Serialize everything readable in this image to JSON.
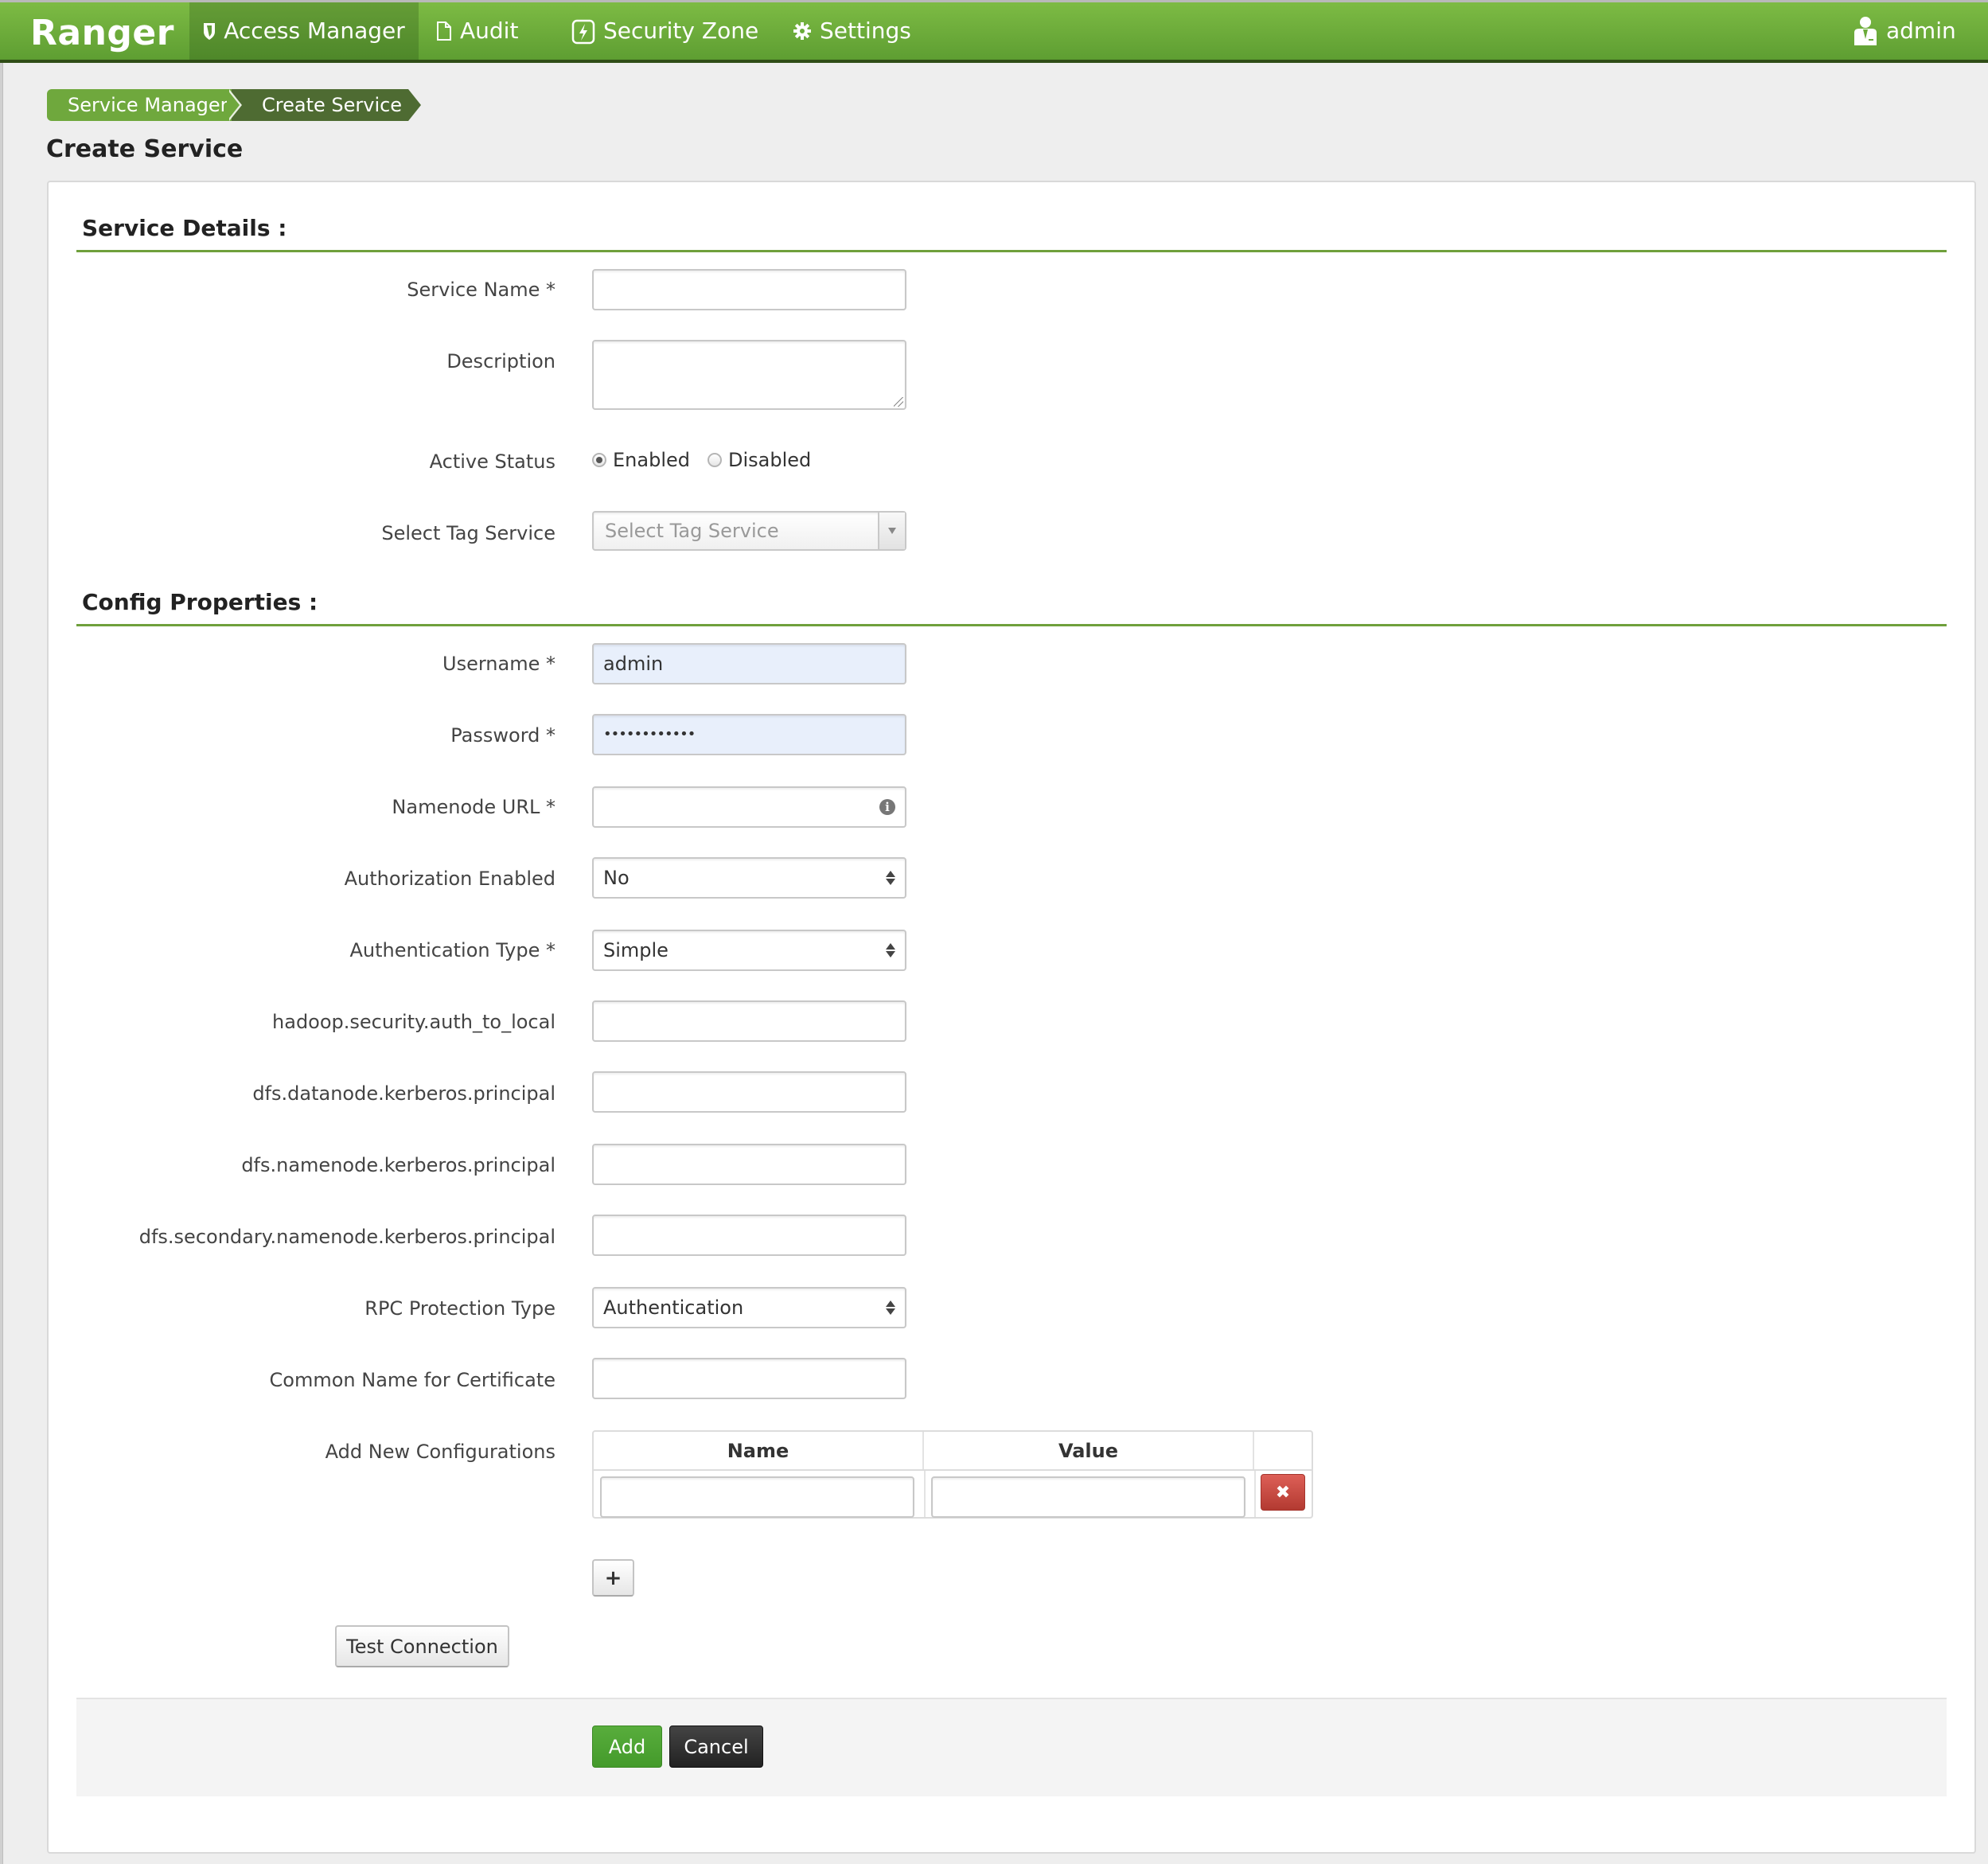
{
  "navbar": {
    "brand": "Ranger",
    "items": [
      {
        "label": "Access Manager",
        "icon": "shield-icon",
        "active": true
      },
      {
        "label": "Audit",
        "icon": "file-icon",
        "active": false
      },
      {
        "label": "Security Zone",
        "icon": "lightning-icon",
        "active": false
      },
      {
        "label": "Settings",
        "icon": "gear-icon",
        "active": false
      }
    ],
    "user": {
      "label": "admin",
      "icon": "user-icon"
    }
  },
  "breadcrumb": [
    "Service Manager",
    "Create Service"
  ],
  "page_title": "Create Service",
  "service_details": {
    "title": "Service Details :",
    "service_name": {
      "label": "Service Name *",
      "value": ""
    },
    "description": {
      "label": "Description",
      "value": ""
    },
    "active_status": {
      "label": "Active Status",
      "options": [
        "Enabled",
        "Disabled"
      ],
      "selected": "Enabled"
    },
    "tag_service": {
      "label": "Select Tag Service",
      "placeholder": "Select Tag Service"
    }
  },
  "config_properties": {
    "title": "Config Properties :",
    "username": {
      "label": "Username *",
      "value": "admin"
    },
    "password": {
      "label": "Password *",
      "value": "••••••••••••"
    },
    "namenode_url": {
      "label": "Namenode URL *",
      "value": "",
      "icon": "info-icon"
    },
    "authorization_enabled": {
      "label": "Authorization Enabled",
      "value": "No"
    },
    "authentication_type": {
      "label": "Authentication Type *",
      "value": "Simple"
    },
    "auth_to_local": {
      "label": "hadoop.security.auth_to_local",
      "value": ""
    },
    "datanode_principal": {
      "label": "dfs.datanode.kerberos.principal",
      "value": ""
    },
    "namenode_principal": {
      "label": "dfs.namenode.kerberos.principal",
      "value": ""
    },
    "secondary_namenode_principal": {
      "label": "dfs.secondary.namenode.kerberos.principal",
      "value": ""
    },
    "rpc_protection": {
      "label": "RPC Protection Type",
      "value": "Authentication"
    },
    "common_name_cert": {
      "label": "Common Name for Certificate",
      "value": ""
    },
    "new_configs": {
      "label": "Add New Configurations",
      "columns": [
        "Name",
        "Value"
      ],
      "rows": [
        {
          "name": "",
          "value": ""
        }
      ],
      "delete_glyph": "✖",
      "add_glyph": "+"
    }
  },
  "buttons": {
    "test_connection": "Test Connection",
    "add": "Add",
    "cancel": "Cancel"
  },
  "colors": {
    "navbar": "#6aab3a",
    "section_line": "#6fa03c",
    "add_button": "#4ea334",
    "cancel_button": "#333333",
    "delete_button": "#c9463d"
  }
}
